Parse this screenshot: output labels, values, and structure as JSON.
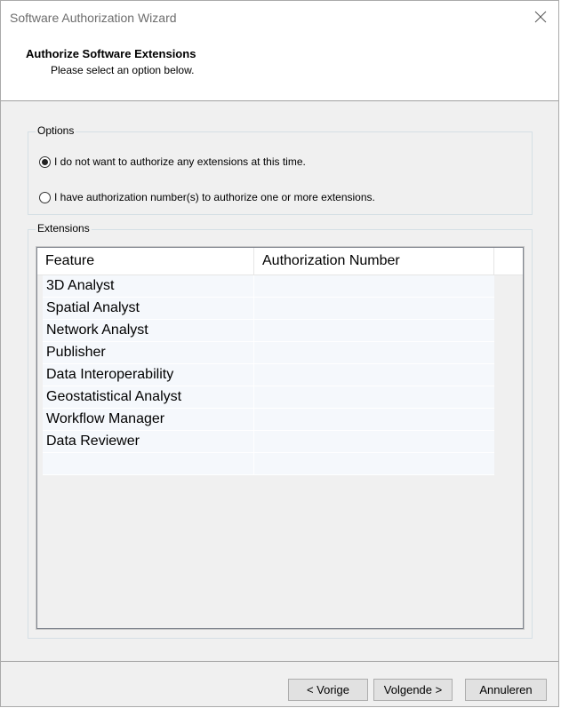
{
  "window": {
    "title": "Software Authorization Wizard"
  },
  "header": {
    "title": "Authorize Software Extensions",
    "subtitle": "Please select an option below."
  },
  "options": {
    "legend": "Options",
    "choice_1": "I do not want to authorize any extensions at this time.",
    "choice_2": "I have authorization number(s) to authorize one or more extensions.",
    "selected": 1
  },
  "extensions": {
    "legend": "Extensions",
    "columns": [
      "Feature",
      "Authorization Number"
    ],
    "rows": [
      {
        "feature": "3D Analyst",
        "auth": ""
      },
      {
        "feature": "Spatial Analyst",
        "auth": ""
      },
      {
        "feature": "Network Analyst",
        "auth": ""
      },
      {
        "feature": "Publisher",
        "auth": ""
      },
      {
        "feature": "Data Interoperability",
        "auth": ""
      },
      {
        "feature": "Geostatistical Analyst",
        "auth": ""
      },
      {
        "feature": "Workflow Manager",
        "auth": ""
      },
      {
        "feature": "Data Reviewer",
        "auth": ""
      },
      {
        "feature": "",
        "auth": ""
      }
    ]
  },
  "buttons": {
    "back": "< Vorige",
    "next": "Volgende >",
    "cancel": "Annuleren"
  }
}
